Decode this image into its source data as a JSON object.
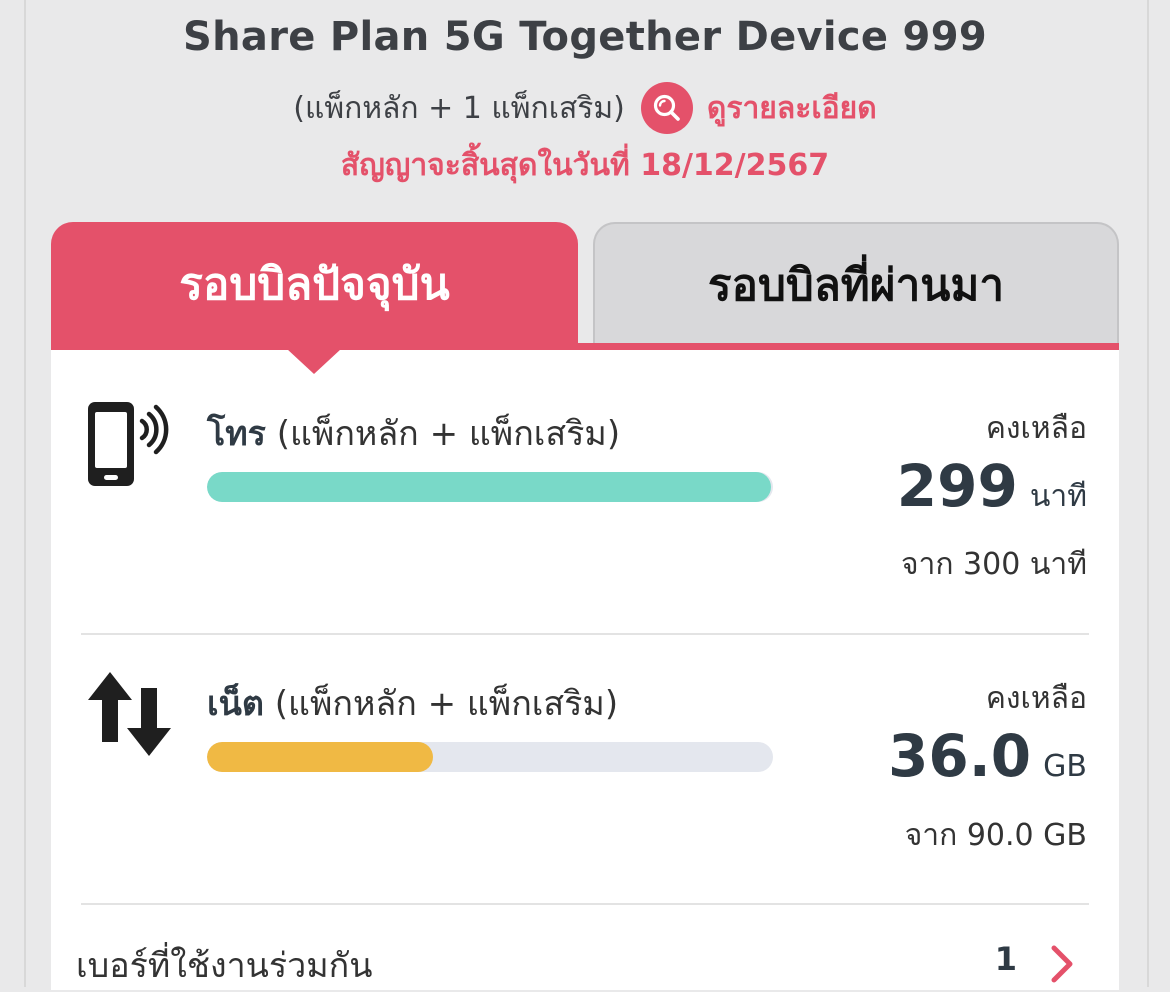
{
  "plan": {
    "name": "Share Plan 5G Together Device 999",
    "package_desc": "(แพ็กหลัก + 1 แพ็กเสริม)",
    "detail_link": "ดูรายละเอียด",
    "contract_end": "สัญญาจะสิ้นสุดในวันที่ 18/12/2567"
  },
  "tabs": {
    "current": "รอบบิลปัจจุบัน",
    "previous": "รอบบิลที่ผ่านมา"
  },
  "call": {
    "title": "โทร",
    "subtitle": "(แพ็กหลัก + แพ็กเสริม)",
    "remaining_label": "คงเหลือ",
    "remaining_value": "299",
    "unit": "นาที",
    "total": "จาก 300 นาที",
    "fraction_remaining": 0.997,
    "bar_color": "#79d9c8",
    "icon": "phone-signal-icon"
  },
  "data": {
    "title": "เน็ต",
    "subtitle": "(แพ็กหลัก + แพ็กเสริม)",
    "remaining_label": "คงเหลือ",
    "remaining_value": "36.0",
    "unit": "GB",
    "total": "จาก 90.0 GB",
    "fraction_remaining": 0.4,
    "bar_color": "#f0b944",
    "icon": "up-down-arrows-icon"
  },
  "shared": {
    "label": "เบอร์ที่ใช้งานร่วมกัน",
    "count": "1"
  },
  "colors": {
    "accent": "#e4516a",
    "track": "#e4e7ee"
  }
}
